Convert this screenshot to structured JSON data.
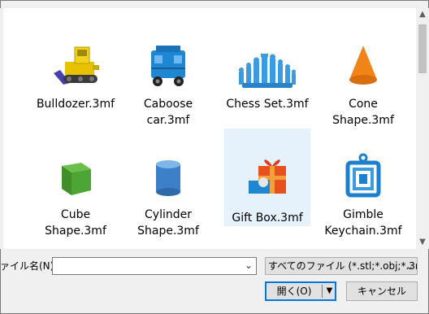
{
  "files": [
    {
      "name_line1": "Bulldozer.3mf",
      "name_line2": "",
      "icon": "bulldozer-icon"
    },
    {
      "name_line1": "Caboose",
      "name_line2": "car.3mf",
      "icon": "caboose-icon"
    },
    {
      "name_line1": "Chess Set.3mf",
      "name_line2": "",
      "icon": "chess-set-icon"
    },
    {
      "name_line1": "Cone",
      "name_line2": "Shape.3mf",
      "icon": "cone-icon"
    },
    {
      "name_line1": "Cube",
      "name_line2": "Shape.3mf",
      "icon": "cube-icon"
    },
    {
      "name_line1": "Cylinder",
      "name_line2": "Shape.3mf",
      "icon": "cylinder-icon"
    },
    {
      "name_line1": "Gift Box.3mf",
      "name_line2": "",
      "icon": "gift-box-icon",
      "selected": true
    },
    {
      "name_line1": "Gimble",
      "name_line2": "Keychain.3mf",
      "icon": "keychain-icon"
    }
  ],
  "footer": {
    "filename_label": "ァイル名(N):",
    "filename_value": "",
    "filter_label": "すべてのファイル (*.stl;*.obj;*.3mf;*",
    "open_label": "開く(O)",
    "cancel_label": "キャンセル"
  },
  "colors": {
    "selection": "#e5f1fb",
    "accent": "#0078d7"
  }
}
